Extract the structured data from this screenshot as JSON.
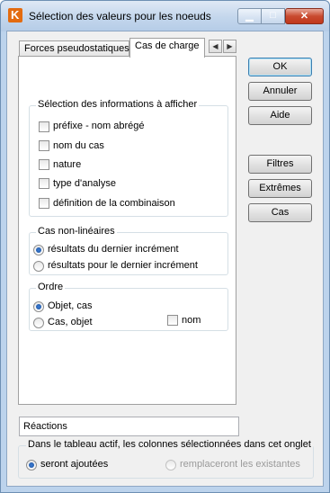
{
  "window": {
    "title": "Sélection des valeurs pour les noeuds",
    "app_icon": "K",
    "close_glyph": "✕",
    "minimize_glyph": "▁",
    "maximize_glyph": "□"
  },
  "tabs": [
    {
      "label": "Forces pseudostatiques",
      "active": false
    },
    {
      "label": "Cas de charge",
      "active": true
    }
  ],
  "tab_scroll": {
    "left": "◀",
    "right": "▶"
  },
  "info_group": {
    "title": "Sélection des informations à afficher",
    "items": [
      {
        "label": "préfixe - nom abrégé",
        "checked": false
      },
      {
        "label": "nom du cas",
        "checked": false
      },
      {
        "label": "nature",
        "checked": false
      },
      {
        "label": "type d'analyse",
        "checked": false
      },
      {
        "label": "définition de la combinaison",
        "checked": false
      }
    ]
  },
  "nonlinear_group": {
    "title": "Cas non-linéaires",
    "options": [
      {
        "label": "résultats du dernier incrément",
        "selected": true
      },
      {
        "label": "résultats pour le dernier incrément",
        "selected": false
      }
    ]
  },
  "order_group": {
    "title": "Ordre",
    "options": [
      {
        "label": "Objet, cas",
        "selected": true
      },
      {
        "label": "Cas, objet",
        "selected": false
      }
    ],
    "nom_label": "nom",
    "nom_checked": false
  },
  "buttons": {
    "ok": "OK",
    "cancel": "Annuler",
    "help": "Aide",
    "filters": "Filtres",
    "extremes": "Extrêmes",
    "cases": "Cas"
  },
  "reactions_field": "Réactions",
  "bottom_group": {
    "title": "Dans le tableau actif, les colonnes sélectionnées dans cet onglet",
    "options": [
      {
        "label": "seront ajoutées",
        "selected": true,
        "enabled": true
      },
      {
        "label": "remplaceront les existantes",
        "selected": false,
        "enabled": false
      }
    ]
  },
  "colors": {
    "title_bar": "#c3d6ec",
    "close_button": "#c94a2f",
    "app_icon": "#e36b10",
    "radio_selected": "#1a4f9c"
  }
}
